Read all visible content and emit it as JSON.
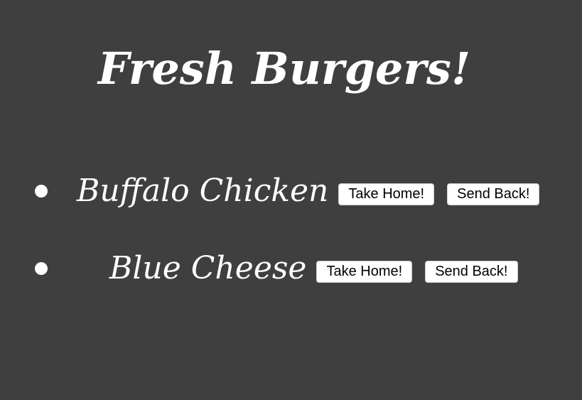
{
  "header": {
    "title": "Fresh Burgers!"
  },
  "burgers": [
    {
      "name": "Buffalo Chicken",
      "take_home_label": "Take Home!",
      "send_back_label": "Send Back!"
    },
    {
      "name": "Blue Cheese",
      "take_home_label": "Take Home!",
      "send_back_label": "Send Back!"
    }
  ],
  "colors": {
    "background": "#3f3f3f",
    "text": "#ffffff",
    "button_background": "#ffffff",
    "button_text": "#000000"
  }
}
